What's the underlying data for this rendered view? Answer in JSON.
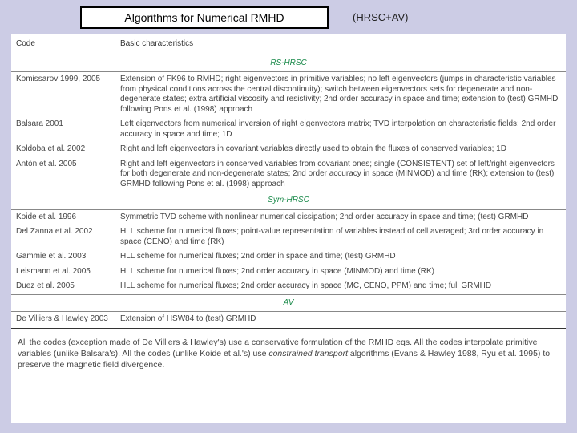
{
  "title": "Algorithms for Numerical RMHD",
  "annot": "(HRSC+AV)",
  "headers": {
    "code": "Code",
    "char": "Basic characteristics"
  },
  "sections": {
    "rs": "RS-HRSC",
    "sym": "Sym-HRSC",
    "av": "AV"
  },
  "rows": {
    "r1": {
      "code": "Komissarov 1999, 2005",
      "desc": "Extension of FK96 to RMHD; right eigenvectors in primitive variables; no left eigenvectors (jumps in characteristic variables from physical conditions across the central discontinuity); switch between eigenvectors sets for degenerate and non-degenerate states; extra artificial viscosity and resistivity; 2nd order accuracy in space and time; extension to (test) GRMHD following Pons et al. (1998) approach"
    },
    "r2": {
      "code": "Balsara 2001",
      "desc": "Left eigenvectors from numerical inversion of right eigenvectors matrix; TVD interpolation on characteristic fields; 2nd order accuracy in space and time; 1D"
    },
    "r3": {
      "code": "Koldoba et al. 2002",
      "desc": "Right and left eigenvectors in covariant variables directly used to obtain the fluxes of conserved variables; 1D"
    },
    "r4": {
      "code": "Antón et al. 2005",
      "desc": "Right and left eigenvectors in conserved variables from covariant ones; single (CONSISTENT) set of left/right eigenvectors for both degenerate and non-degenerate states; 2nd order accuracy in space (MINMOD) and time (RK); extension to (test) GRMHD following Pons et al. (1998) approach"
    },
    "r5": {
      "code": "Koide et al. 1996",
      "desc": "Symmetric TVD scheme with nonlinear numerical dissipation; 2nd order accuracy in space and time; (test) GRMHD"
    },
    "r6": {
      "code": "Del Zanna et al. 2002",
      "desc": "HLL scheme for numerical fluxes; point-value representation of variables instead of cell averaged; 3rd order accuracy in space (CENO) and time (RK)"
    },
    "r7": {
      "code": "Gammie et al. 2003",
      "desc": "HLL scheme for numerical fluxes; 2nd order in space and time; (test) GRMHD"
    },
    "r8": {
      "code": "Leismann et al. 2005",
      "desc": "HLL scheme for numerical fluxes; 2nd order accuracy in space (MINMOD) and time (RK)"
    },
    "r9": {
      "code": "Duez et al. 2005",
      "desc": "HLL scheme for numerical fluxes; 2nd order accuracy in space (MC, CENO, PPM) and time; full GRMHD"
    },
    "r10": {
      "code": "De Villiers & Hawley 2003",
      "desc": "Extension of HSW84 to (test) GRMHD"
    }
  },
  "footer": {
    "p1a": "All the codes (exception made of De Villiers & Hawley's) use a conservative formulation of the RMHD eqs. All the codes interpolate primitive variables (unlike Balsara's). All the codes (unlike Koide et al.'s) use ",
    "p1b": "constrained transport",
    "p1c": " algorithms (Evans & Hawley 1988, Ryu et al. 1995) to preserve the magnetic field divergence."
  }
}
